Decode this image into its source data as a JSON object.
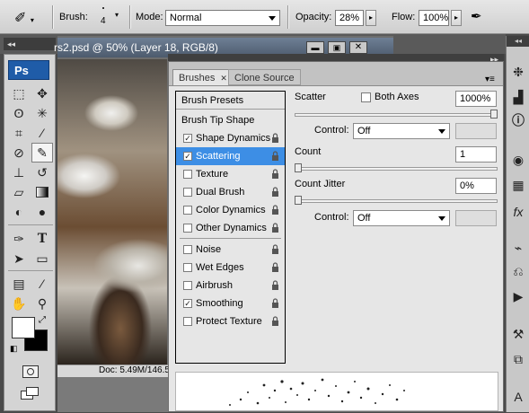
{
  "options_bar": {
    "brush_label": "Brush:",
    "brush_size": "4",
    "mode_label": "Mode:",
    "mode_value": "Normal",
    "opacity_label": "Opacity:",
    "opacity_value": "28%",
    "flow_label": "Flow:",
    "flow_value": "100%"
  },
  "document": {
    "title": "rs2.psd @ 50% (Layer 18, RGB/8)",
    "status": "Doc: 5.49M/146.5"
  },
  "toolbox": {
    "logo": "Ps"
  },
  "brushes_panel": {
    "tabs": [
      {
        "label": "Brushes",
        "active": true
      },
      {
        "label": "Clone Source",
        "active": false
      }
    ],
    "presets_label": "Brush Presets",
    "tip_shape_label": "Brush Tip Shape",
    "options": [
      {
        "label": "Shape Dynamics",
        "checked": true,
        "selected": false
      },
      {
        "label": "Scattering",
        "checked": true,
        "selected": true
      },
      {
        "label": "Texture",
        "checked": false,
        "selected": false
      },
      {
        "label": "Dual Brush",
        "checked": false,
        "selected": false
      },
      {
        "label": "Color Dynamics",
        "checked": false,
        "selected": false
      },
      {
        "label": "Other Dynamics",
        "checked": false,
        "selected": false
      },
      {
        "label": "Noise",
        "checked": false,
        "selected": false
      },
      {
        "label": "Wet Edges",
        "checked": false,
        "selected": false
      },
      {
        "label": "Airbrush",
        "checked": false,
        "selected": false
      },
      {
        "label": "Smoothing",
        "checked": true,
        "selected": false
      },
      {
        "label": "Protect Texture",
        "checked": false,
        "selected": false
      }
    ],
    "scatter_label": "Scatter",
    "both_axes_label": "Both Axes",
    "both_axes_checked": false,
    "scatter_value": "1000%",
    "scatter_level": 1.0,
    "control1_label": "Control:",
    "control1_value": "Off",
    "count_label": "Count",
    "count_value": "1",
    "count_level": 0.0,
    "count_jitter_label": "Count Jitter",
    "count_jitter_value": "0%",
    "count_jitter_level": 0.0,
    "control2_label": "Control:",
    "control2_value": "Off"
  },
  "colors": {
    "highlight": "#3d8ee5",
    "ps_logo_bg": "#1f5ca8"
  }
}
